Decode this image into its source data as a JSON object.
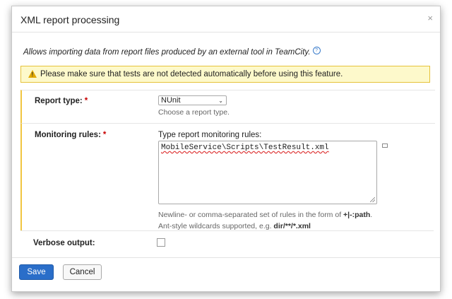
{
  "dialog": {
    "title": "XML report processing",
    "close_glyph": "×",
    "description": "Allows importing data from report files produced by an external tool in TeamCity.",
    "help_icon": "?",
    "warning": "Please make sure that tests are not detected automatically before using this feature.",
    "warning_glyph": "!"
  },
  "report_type": {
    "label": "Report type:",
    "required_mark": "*",
    "selected": "NUnit",
    "hint": "Choose a report type."
  },
  "monitoring_rules": {
    "label": "Monitoring rules:",
    "required_mark": "*",
    "field_label": "Type report monitoring rules:",
    "value": "MobileService\\Scripts\\TestResult.xml",
    "hint1_prefix": "Newline- or comma-separated set of rules in the form of ",
    "hint1_bold": "+|-:path",
    "hint1_suffix": ".",
    "hint2_prefix": "Ant-style wildcards supported, e.g. ",
    "hint2_bold": "dir/**/*.xml"
  },
  "verbose": {
    "label": "Verbose output:",
    "checked": false
  },
  "buttons": {
    "save": "Save",
    "cancel": "Cancel"
  },
  "colors": {
    "primary": "#2a6ec9",
    "warning_bg": "#fdf9cb",
    "warning_border": "#e6c23a",
    "required": "#c80000"
  }
}
